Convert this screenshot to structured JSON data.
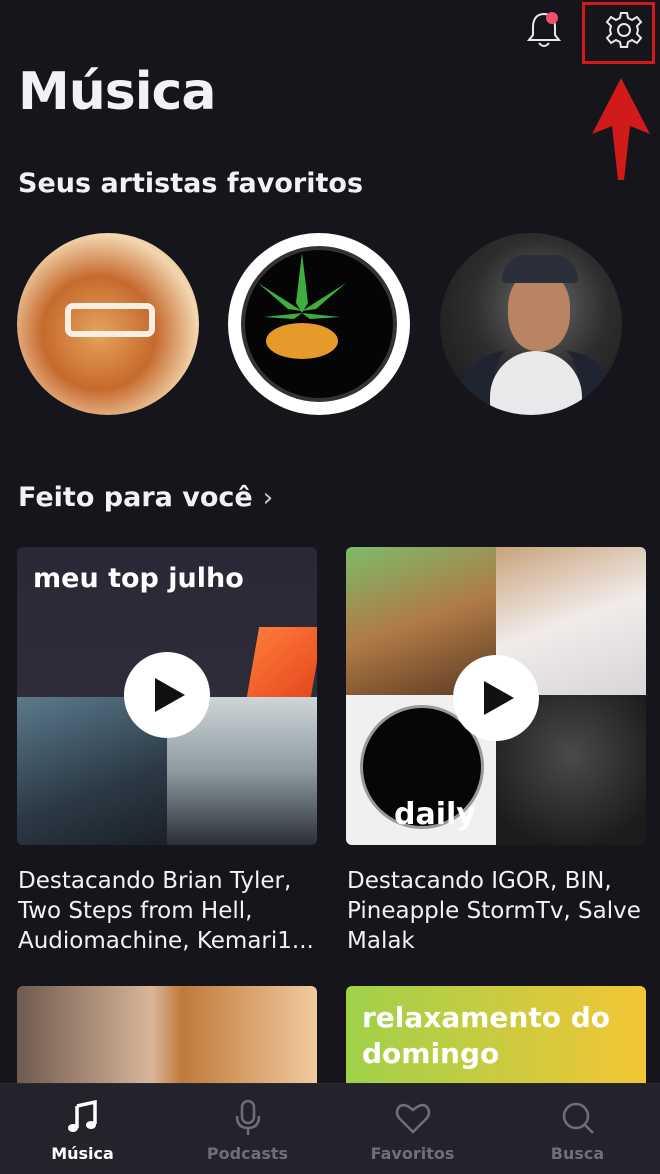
{
  "header": {
    "title": "Música",
    "notifications_icon": "bell-icon",
    "notification_badge_color": "#f0506e",
    "settings_icon": "gear-icon",
    "annotation_color": "#d11b1b"
  },
  "favorites": {
    "title": "Seus artistas favoritos"
  },
  "made_for_you": {
    "title": "Feito para você",
    "chevron": "›",
    "cards": [
      {
        "label": "meu top julho",
        "description_lines": [
          "Destacando Brian Tyler,",
          "Two Steps from Hell,",
          "Audiomachine, Kemari1..."
        ]
      },
      {
        "label": "daily",
        "description_lines": [
          "Destacando IGOR, BIN,",
          "Pineapple StormTv, Salve",
          "Malak"
        ]
      }
    ],
    "more_cards": [
      {
        "label": ""
      },
      {
        "label": "relaxamento do domingo"
      }
    ]
  },
  "tabbar": {
    "tabs": [
      {
        "label": "Música",
        "icon": "music-note-icon",
        "active": true
      },
      {
        "label": "Podcasts",
        "icon": "microphone-icon",
        "active": false
      },
      {
        "label": "Favoritos",
        "icon": "heart-icon",
        "active": false
      },
      {
        "label": "Busca",
        "icon": "search-icon",
        "active": false
      }
    ]
  }
}
